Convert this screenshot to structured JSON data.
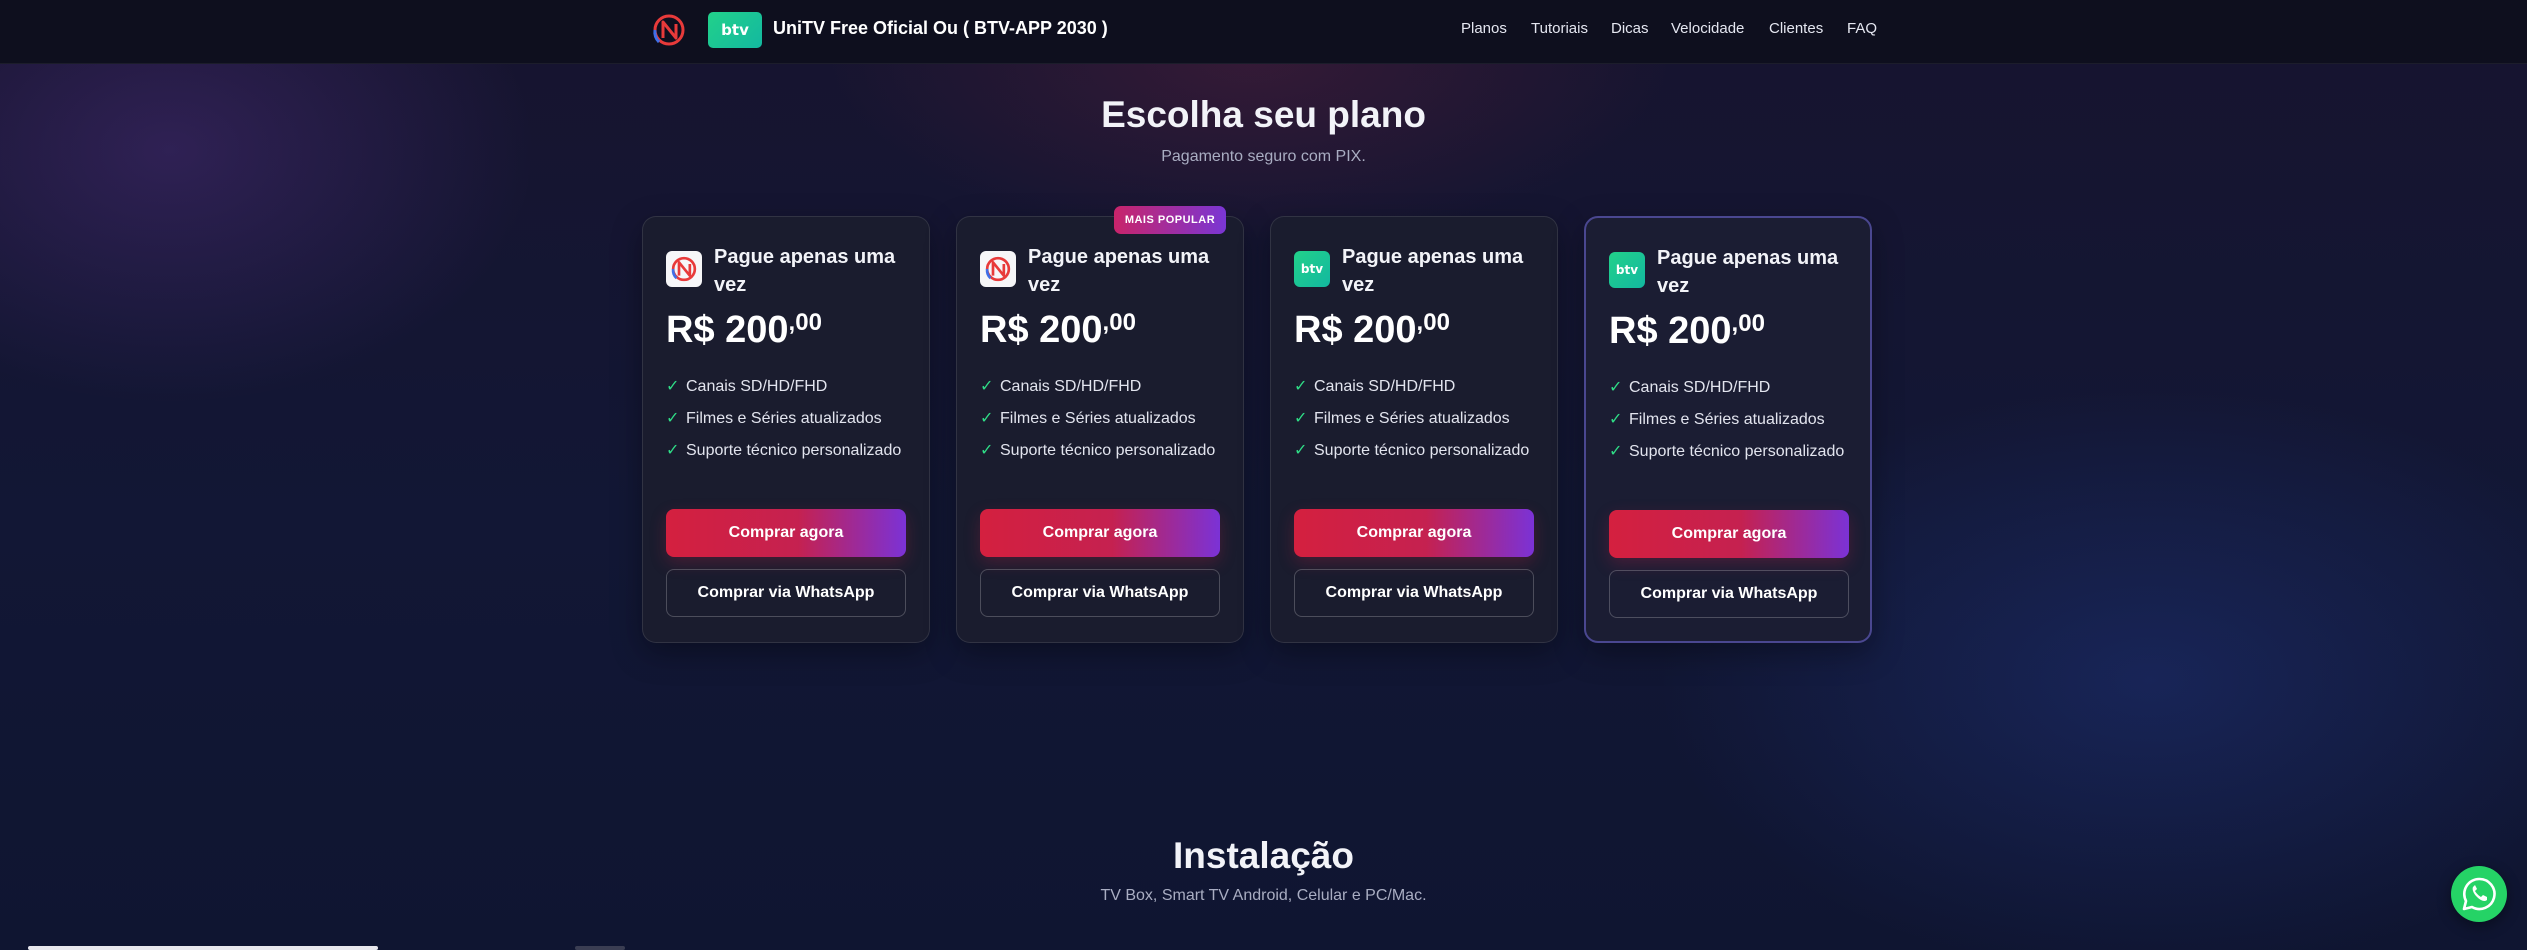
{
  "header": {
    "brand_title": "UniTV Free Oficial Ou ( BTV-APP 2030 )",
    "btv_logo_text": "btv",
    "nav": [
      "Planos",
      "Tutoriais",
      "Dicas",
      "Velocidade",
      "Clientes",
      "FAQ"
    ]
  },
  "plans_section": {
    "title": "Escolha seu plano",
    "subtitle": "Pagamento seguro com PIX.",
    "popular_badge": "MAIS POPULAR",
    "cards": [
      {
        "icon": "unitv-logo-icon",
        "title": "Pague apenas uma vez",
        "price_main": "R$ 200",
        "price_cents": ",00",
        "features": [
          "Canais SD/HD/FHD",
          "Filmes e Séries atualizados",
          "Suporte técnico personalizado"
        ],
        "buy_label": "Comprar agora",
        "whatsapp_label": "Comprar via WhatsApp"
      },
      {
        "icon": "unitv-logo-icon",
        "title": "Pague apenas uma vez",
        "price_main": "R$ 200",
        "price_cents": ",00",
        "features": [
          "Canais SD/HD/FHD",
          "Filmes e Séries atualizados",
          "Suporte técnico personalizado"
        ],
        "buy_label": "Comprar agora",
        "whatsapp_label": "Comprar via WhatsApp"
      },
      {
        "icon": "btv-logo-icon",
        "icon_text": "btv",
        "title": "Pague apenas uma vez",
        "price_main": "R$ 200",
        "price_cents": ",00",
        "features": [
          "Canais SD/HD/FHD",
          "Filmes e Séries atualizados",
          "Suporte técnico personalizado"
        ],
        "buy_label": "Comprar agora",
        "whatsapp_label": "Comprar via WhatsApp"
      },
      {
        "icon": "btv-logo-icon",
        "icon_text": "btv",
        "title": "Pague apenas uma vez",
        "price_main": "R$ 200",
        "price_cents": ",00",
        "features": [
          "Canais SD/HD/FHD",
          "Filmes e Séries atualizados",
          "Suporte técnico personalizado"
        ],
        "buy_label": "Comprar agora",
        "whatsapp_label": "Comprar via WhatsApp"
      }
    ]
  },
  "install_section": {
    "title": "Instalação",
    "subtitle": "TV Box, Smart TV Android, Celular e PC/Mac."
  },
  "colors": {
    "accent_red": "#d4203f",
    "accent_purple": "#7b32d6",
    "check_green": "#2fdc86",
    "whatsapp_green": "#25d366"
  }
}
